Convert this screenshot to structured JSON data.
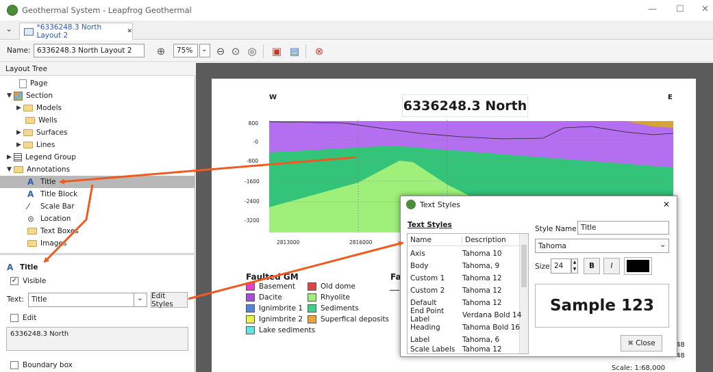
{
  "window": {
    "title": "Geothermal System - Leapfrog Geothermal",
    "minimize": "—",
    "maximize": "☐",
    "close": "✕"
  },
  "tab": {
    "chevron": "⌄",
    "label": "*6336248.3 North Layout 2",
    "close": "✕"
  },
  "toolbar": {
    "name_label": "Name:",
    "name_value": "6336248.3 North Layout 2",
    "zoom_value": "75%",
    "zoom_arrow": "⌄"
  },
  "layout_tree": {
    "header": "Layout Tree",
    "items": [
      {
        "label": "Page"
      },
      {
        "label": "Section"
      },
      {
        "label": "Models"
      },
      {
        "label": "Wells"
      },
      {
        "label": "Surfaces"
      },
      {
        "label": "Lines"
      },
      {
        "label": "Legend Group"
      },
      {
        "label": "Annotations"
      },
      {
        "label": "Title"
      },
      {
        "label": "Title Block"
      },
      {
        "label": "Scale Bar"
      },
      {
        "label": "Location"
      },
      {
        "label": "Text Boxes"
      },
      {
        "label": "Images"
      }
    ]
  },
  "properties": {
    "title": "Title",
    "visible_label": "Visible",
    "text_label": "Text:",
    "text_value": "Title",
    "edit_styles": "Edit Styles",
    "edit_label": "Edit",
    "edit_value": "6336248.3 North",
    "boundary_label": "Boundary box",
    "check_mark": "✓"
  },
  "sheet": {
    "west": "W",
    "east": "E",
    "title": "6336248.3 North",
    "y_ticks": [
      "800",
      "-0",
      "-800",
      "-1600",
      "-2400",
      "-3200"
    ],
    "x_ticks": [
      "2813000",
      "2816000"
    ],
    "legend_title": "Faulted GM",
    "legend_title2": "Fa",
    "legend": [
      {
        "label": "Basement",
        "color": "#e540c8"
      },
      {
        "label": "Dacite",
        "color": "#a64fd8"
      },
      {
        "label": "Ignimbrite 1",
        "color": "#4f86dd"
      },
      {
        "label": "Ignimbrite 2",
        "color": "#e8f24a"
      },
      {
        "label": "Lake sediments",
        "color": "#5fe3e3"
      },
      {
        "label": "Old dome",
        "color": "#e04545"
      },
      {
        "label": "Rhyolite",
        "color": "#9ef07a"
      },
      {
        "label": "Sediments",
        "color": "#3fcf86"
      },
      {
        "label": "Superfical deposits",
        "color": "#e8a43a"
      }
    ],
    "scale_text": "Scale: 1:68,000",
    "partial_48a": "48",
    "partial_48b": "48"
  },
  "dialog": {
    "title": "Text Styles",
    "close": "✕",
    "list_title": "Text Styles",
    "col_name": "Name",
    "col_desc": "Description",
    "rows": [
      {
        "name": "Axis",
        "desc": "Tahoma 10"
      },
      {
        "name": "Body",
        "desc": "Tahoma, 9"
      },
      {
        "name": "Custom 1",
        "desc": "Tahoma 12"
      },
      {
        "name": "Custom 2",
        "desc": "Tahoma 12"
      },
      {
        "name": "Default",
        "desc": "Tahoma 12"
      },
      {
        "name": "End Point Label",
        "desc": "Verdana Bold 14"
      },
      {
        "name": "Heading",
        "desc": "Tahoma Bold 16"
      },
      {
        "name": "Label",
        "desc": "Tahoma, 6"
      },
      {
        "name": "Scale Labels",
        "desc": "Tahoma 12"
      }
    ],
    "style_name_label": "Style Name:",
    "style_name_value": "Title",
    "font_value": "Tahoma",
    "font_arrow": "⌄",
    "size_label": "Size:",
    "size_value": "24",
    "bold": "B",
    "italic": "I",
    "sample": "Sample 123",
    "close_button": "Close",
    "text_color": "#000000"
  },
  "colors": {
    "arrow": "#f05a1e",
    "selection": "#b8b8b8"
  }
}
